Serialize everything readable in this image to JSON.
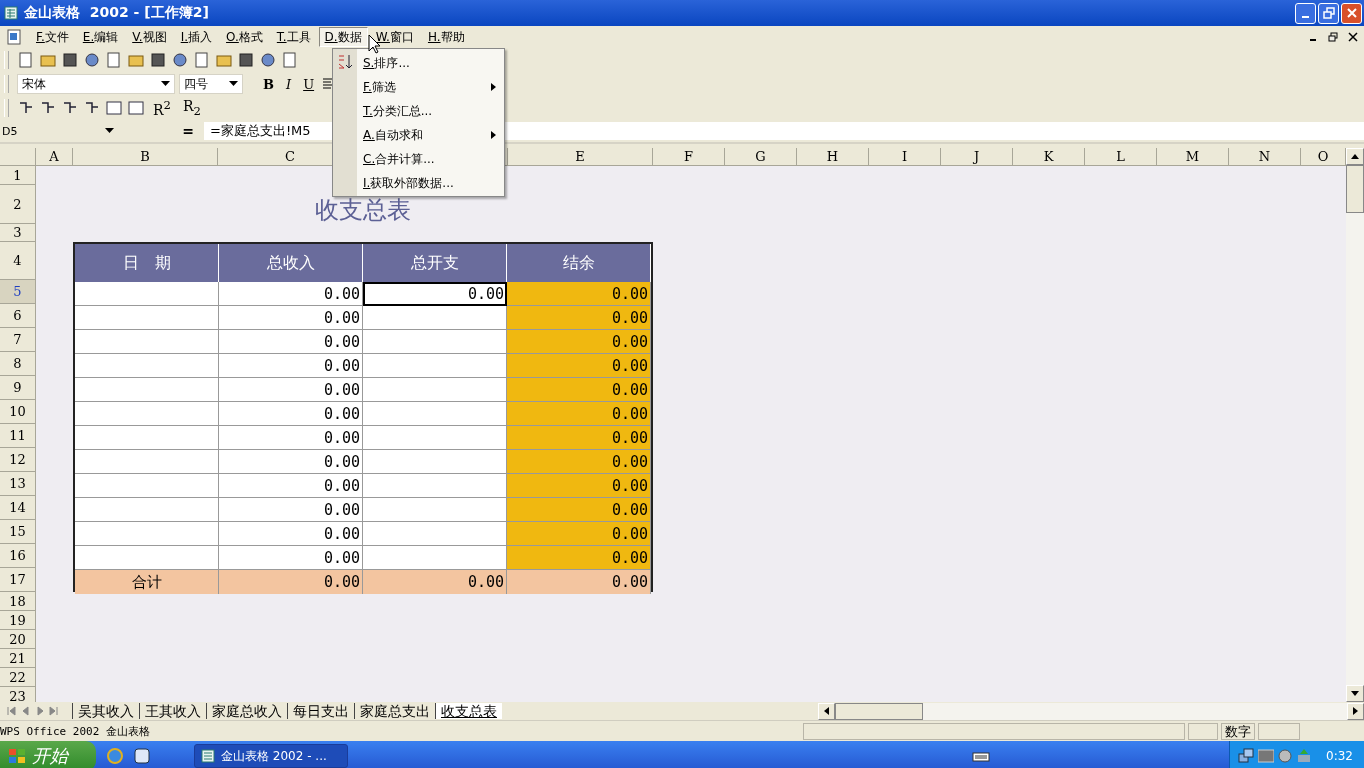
{
  "window": {
    "title": "金山表格  2002 - [工作簿2]"
  },
  "menu": [
    {
      "label": "F.文件",
      "selected": false
    },
    {
      "label": "E.编辑",
      "selected": false
    },
    {
      "label": "V.视图",
      "selected": false
    },
    {
      "label": "I.插入",
      "selected": false
    },
    {
      "label": "O.格式",
      "selected": false
    },
    {
      "label": "T.工具",
      "selected": false
    },
    {
      "label": "D.数据",
      "selected": true
    },
    {
      "label": "W.窗口",
      "selected": false
    },
    {
      "label": "H.帮助",
      "selected": false
    }
  ],
  "dropdown": [
    {
      "label": "S.排序...",
      "submenu": false
    },
    {
      "label": "F.筛选",
      "submenu": true
    },
    {
      "label": "T.分类汇总...",
      "submenu": false
    },
    {
      "label": "A.自动求和",
      "submenu": true
    },
    {
      "label": "C.合并计算...",
      "submenu": false
    },
    {
      "label": "I.获取外部数据...",
      "submenu": false
    }
  ],
  "format_bar": {
    "font": "宋体",
    "size": "四号",
    "bold": "B",
    "italic": "I",
    "underline": "U"
  },
  "superscript": "R$^{2}$",
  "subscript": "R$_{2}$",
  "formula_bar": {
    "cell": "D5",
    "equals": "=",
    "formula": "=家庭总支出!M5"
  },
  "columns": [
    "A",
    "B",
    "C",
    "E",
    "F",
    "G",
    "H",
    "I",
    "J",
    "K",
    "L",
    "M",
    "N",
    "O"
  ],
  "row_numbers": [
    {
      "label": "1",
      "selected": false
    },
    {
      "label": "2",
      "selected": false
    },
    {
      "label": "3",
      "selected": false
    },
    {
      "label": "4",
      "selected": false
    },
    {
      "label": "5",
      "selected": true
    },
    {
      "label": "6",
      "selected": false
    },
    {
      "label": "7",
      "selected": false
    },
    {
      "label": "8",
      "selected": false
    },
    {
      "label": "9",
      "selected": false
    },
    {
      "label": "10",
      "selected": false
    },
    {
      "label": "11",
      "selected": false
    },
    {
      "label": "12",
      "selected": false
    },
    {
      "label": "13",
      "selected": false
    },
    {
      "label": "14",
      "selected": false
    },
    {
      "label": "15",
      "selected": false
    },
    {
      "label": "16",
      "selected": false
    },
    {
      "label": "17",
      "selected": false
    },
    {
      "label": "18",
      "selected": false
    },
    {
      "label": "19",
      "selected": false
    },
    {
      "label": "20",
      "selected": false
    },
    {
      "label": "21",
      "selected": false
    },
    {
      "label": "22",
      "selected": false
    },
    {
      "label": "23",
      "selected": false
    }
  ],
  "sheet_title": "收支总表",
  "table": {
    "headers": [
      "日　期",
      "总收入",
      "总开支",
      "结余"
    ],
    "rows": [
      {
        "date": "",
        "income": "0.00",
        "expense": "0.00",
        "balance": "0.00",
        "selected": true
      },
      {
        "date": "",
        "income": "0.00",
        "expense": "",
        "balance": "0.00",
        "selected": false
      },
      {
        "date": "",
        "income": "0.00",
        "expense": "",
        "balance": "0.00",
        "selected": false
      },
      {
        "date": "",
        "income": "0.00",
        "expense": "",
        "balance": "0.00",
        "selected": false
      },
      {
        "date": "",
        "income": "0.00",
        "expense": "",
        "balance": "0.00",
        "selected": false
      },
      {
        "date": "",
        "income": "0.00",
        "expense": "",
        "balance": "0.00",
        "selected": false
      },
      {
        "date": "",
        "income": "0.00",
        "expense": "",
        "balance": "0.00",
        "selected": false
      },
      {
        "date": "",
        "income": "0.00",
        "expense": "",
        "balance": "0.00",
        "selected": false
      },
      {
        "date": "",
        "income": "0.00",
        "expense": "",
        "balance": "0.00",
        "selected": false
      },
      {
        "date": "",
        "income": "0.00",
        "expense": "",
        "balance": "0.00",
        "selected": false
      },
      {
        "date": "",
        "income": "0.00",
        "expense": "",
        "balance": "0.00",
        "selected": false
      },
      {
        "date": "",
        "income": "0.00",
        "expense": "",
        "balance": "0.00",
        "selected": false
      }
    ],
    "total": {
      "label": "合计",
      "income": "0.00",
      "expense": "0.00",
      "balance": "0.00"
    }
  },
  "sheet_tabs": [
    {
      "label": "吴其收入",
      "selected": false
    },
    {
      "label": "王其收入",
      "selected": false
    },
    {
      "label": "家庭总收入",
      "selected": false
    },
    {
      "label": "每日支出",
      "selected": false
    },
    {
      "label": "家庭总支出",
      "selected": false
    },
    {
      "label": "收支总表",
      "selected": true
    }
  ],
  "status_bar": {
    "text": "WPS Office 2002 金山表格",
    "mode": "数字"
  },
  "taskbar": {
    "start": "开始",
    "task": "金山表格 2002 - ...",
    "clock": "0:32"
  }
}
